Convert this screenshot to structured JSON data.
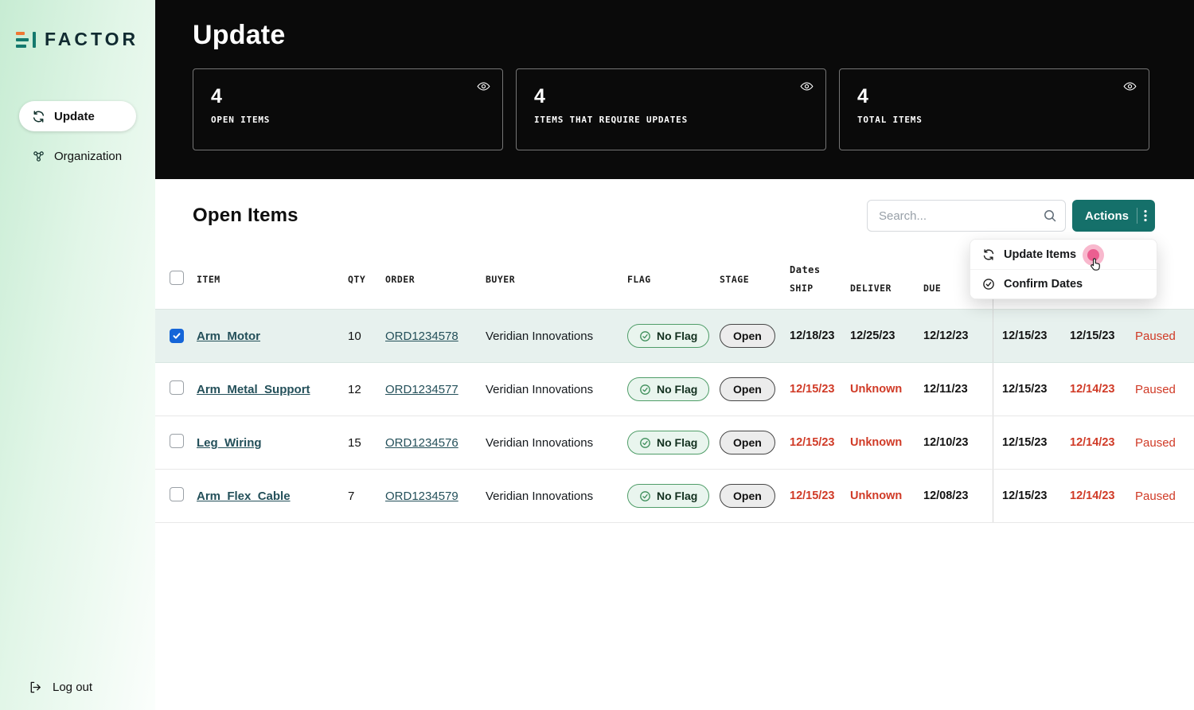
{
  "colors": {
    "accent_teal": "#15706a",
    "alert_red": "#d03a26",
    "flag_green": "#3e8e5a",
    "checkbox_blue": "#1565d8",
    "click_pink": "#e94e85"
  },
  "sidebar": {
    "logo_text": "FACTOR",
    "nav": [
      {
        "label": "Update",
        "icon": "refresh-icon",
        "active": true
      },
      {
        "label": "Organization",
        "icon": "organization-icon",
        "active": false
      }
    ],
    "logout_label": "Log out"
  },
  "header": {
    "title": "Update",
    "stats": [
      {
        "value": "4",
        "label": "OPEN ITEMS"
      },
      {
        "value": "4",
        "label": "ITEMS THAT REQUIRE UPDATES"
      },
      {
        "value": "4",
        "label": "TOTAL ITEMS"
      }
    ]
  },
  "main": {
    "section_title": "Open Items",
    "search": {
      "placeholder": "Search..."
    },
    "actions_button": "Actions",
    "actions_menu": [
      {
        "label": "Update Items",
        "icon": "refresh-icon"
      },
      {
        "label": "Confirm Dates",
        "icon": "check-circle-icon"
      }
    ],
    "table": {
      "headers": {
        "item": "ITEM",
        "qty": "QTY",
        "order": "ORDER",
        "buyer": "BUYER",
        "flag": "FLAG",
        "stage": "STAGE",
        "dates_group": "Dates",
        "ship": "SHIP",
        "deliver": "DELIVER",
        "due": "DUE"
      },
      "rows": [
        {
          "selected": true,
          "item": "Arm_Motor",
          "qty": "10",
          "order": "ORD1234578",
          "buyer": "Veridian Innovations",
          "flag": "No Flag",
          "stage": "Open",
          "dates": [
            {
              "text": "12/18/23",
              "alert": false
            },
            {
              "text": "12/25/23",
              "alert": false
            },
            {
              "text": "12/12/23",
              "alert": false
            },
            {
              "text": "12/15/23",
              "alert": false
            },
            {
              "text": "12/15/23",
              "alert": false
            }
          ],
          "status": {
            "text": "Paused",
            "alert": true
          }
        },
        {
          "selected": false,
          "item": "Arm_Metal_Support",
          "qty": "12",
          "order": "ORD1234577",
          "buyer": "Veridian Innovations",
          "flag": "No Flag",
          "stage": "Open",
          "dates": [
            {
              "text": "12/15/23",
              "alert": true
            },
            {
              "text": "Unknown",
              "alert": true
            },
            {
              "text": "12/11/23",
              "alert": false
            },
            {
              "text": "12/15/23",
              "alert": false
            },
            {
              "text": "12/14/23",
              "alert": true
            }
          ],
          "status": {
            "text": "Paused",
            "alert": true
          }
        },
        {
          "selected": false,
          "item": "Leg_Wiring",
          "qty": "15",
          "order": "ORD1234576",
          "buyer": "Veridian Innovations",
          "flag": "No Flag",
          "stage": "Open",
          "dates": [
            {
              "text": "12/15/23",
              "alert": true
            },
            {
              "text": "Unknown",
              "alert": true
            },
            {
              "text": "12/10/23",
              "alert": false
            },
            {
              "text": "12/15/23",
              "alert": false
            },
            {
              "text": "12/14/23",
              "alert": true
            }
          ],
          "status": {
            "text": "Paused",
            "alert": true
          }
        },
        {
          "selected": false,
          "item": "Arm_Flex_Cable",
          "qty": "7",
          "order": "ORD1234579",
          "buyer": "Veridian Innovations",
          "flag": "No Flag",
          "stage": "Open",
          "dates": [
            {
              "text": "12/15/23",
              "alert": true
            },
            {
              "text": "Unknown",
              "alert": true
            },
            {
              "text": "12/08/23",
              "alert": false
            },
            {
              "text": "12/15/23",
              "alert": false
            },
            {
              "text": "12/14/23",
              "alert": true
            }
          ],
          "status": {
            "text": "Paused",
            "alert": true
          }
        }
      ]
    }
  }
}
